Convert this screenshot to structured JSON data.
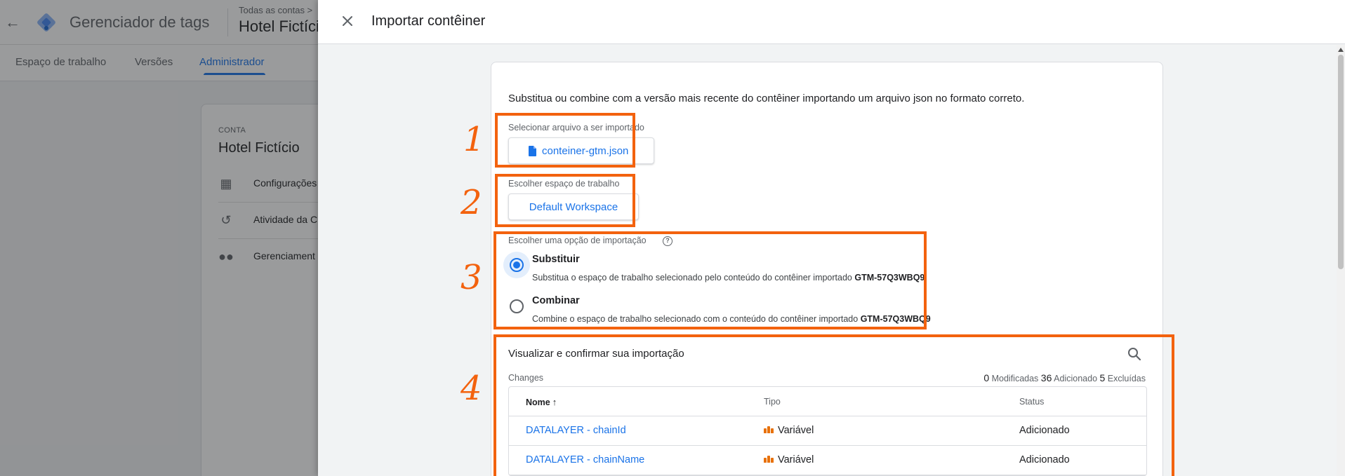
{
  "background": {
    "product_name": "Gerenciador de tags",
    "breadcrumb": "Todas as contas >",
    "account_name": "Hotel Fictício",
    "tabs": [
      {
        "label": "Espaço de trabalho"
      },
      {
        "label": "Versões"
      },
      {
        "label": "Administrador",
        "active": true
      }
    ],
    "card": {
      "kicker": "CONTA",
      "title": "Hotel Fictício",
      "items": [
        {
          "label": "Configurações",
          "icon": "building-icon"
        },
        {
          "label": "Atividade da C",
          "icon": "history-icon"
        },
        {
          "label": "Gerenciament",
          "icon": "people-icon"
        }
      ]
    }
  },
  "dialog": {
    "title": "Importar contêiner",
    "intro": "Substitua ou combine com a versão mais recente do contêiner importando um arquivo json no formato correto.",
    "file": {
      "label": "Selecionar arquivo a ser importado",
      "filename": "conteiner-gtm.json"
    },
    "workspace": {
      "label": "Escolher espaço de trabalho",
      "value": "Default Workspace"
    },
    "import_option": {
      "label": "Escolher uma opção de importação",
      "container_id": "GTM-57Q3WBQ9",
      "options": [
        {
          "title": "Substituir",
          "description": "Substitua o espaço de trabalho selecionado pelo conteúdo do contêiner importado",
          "checked": true
        },
        {
          "title": "Combinar",
          "description": "Combine o espaço de trabalho selecionado com o conteúdo do contêiner importado",
          "checked": false
        }
      ]
    },
    "preview": {
      "title": "Visualizar e confirmar sua importação",
      "changes_label": "Changes",
      "modified_count": "0",
      "modified_label": "Modificadas",
      "added_count": "36",
      "added_label": "Adicionado",
      "deleted_count": "5",
      "deleted_label": "Excluídas",
      "columns": [
        "Nome",
        "Tipo",
        "Status"
      ],
      "sort_icon": "arrow-up-icon",
      "rows": [
        {
          "name": "DATALAYER - chainId",
          "type": "Variável",
          "status": "Adicionado"
        },
        {
          "name": "DATALAYER - chainName",
          "type": "Variável",
          "status": "Adicionado"
        }
      ]
    }
  },
  "annotations": {
    "color": "#f3620e",
    "numbers": [
      "1",
      "2",
      "3",
      "4"
    ]
  },
  "colors": {
    "accent": "#1a73e8",
    "annotation": "#f3620e",
    "variable_icon": "#e8710a"
  }
}
